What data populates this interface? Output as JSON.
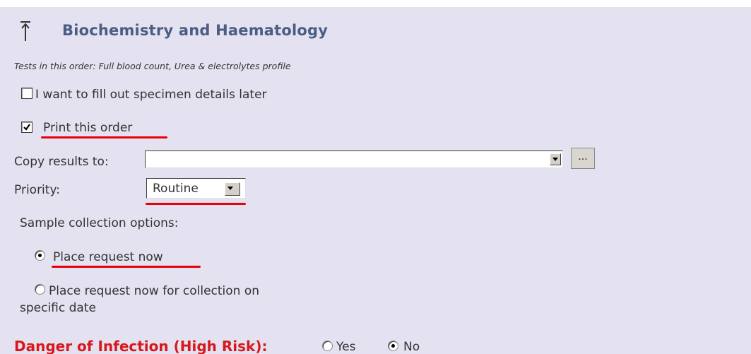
{
  "panel": {
    "title": "Biochemistry and Haematology",
    "tests_line": "Tests in this order: Full blood count, Urea & electrolytes profile",
    "colors": {
      "background": "#e4e2f0",
      "title": "#4a5d83",
      "danger": "#d8171b",
      "annotation_underline": "#e8000a"
    }
  },
  "options": {
    "specimen_later": {
      "label": "I want to fill out specimen details later",
      "checked": false
    },
    "print_order": {
      "label": "Print this order",
      "checked": true
    }
  },
  "copy_results": {
    "label": "Copy results to:",
    "value": "",
    "browse_label": "..."
  },
  "priority": {
    "label": "Priority:",
    "value": "Routine"
  },
  "sample_collection": {
    "heading": "Sample collection options:",
    "place_now": {
      "label": "Place request now",
      "selected": true
    },
    "place_specific_line1": "Place request now for collection on",
    "place_specific_line2": "specific date"
  },
  "infection": {
    "label": "Danger of Infection (High Risk):",
    "yes_label": "Yes",
    "no_label": "No",
    "selected": "No"
  },
  "icons": {
    "collapse": "collapse-up-icon",
    "dropdown": "chevron-down-icon"
  }
}
